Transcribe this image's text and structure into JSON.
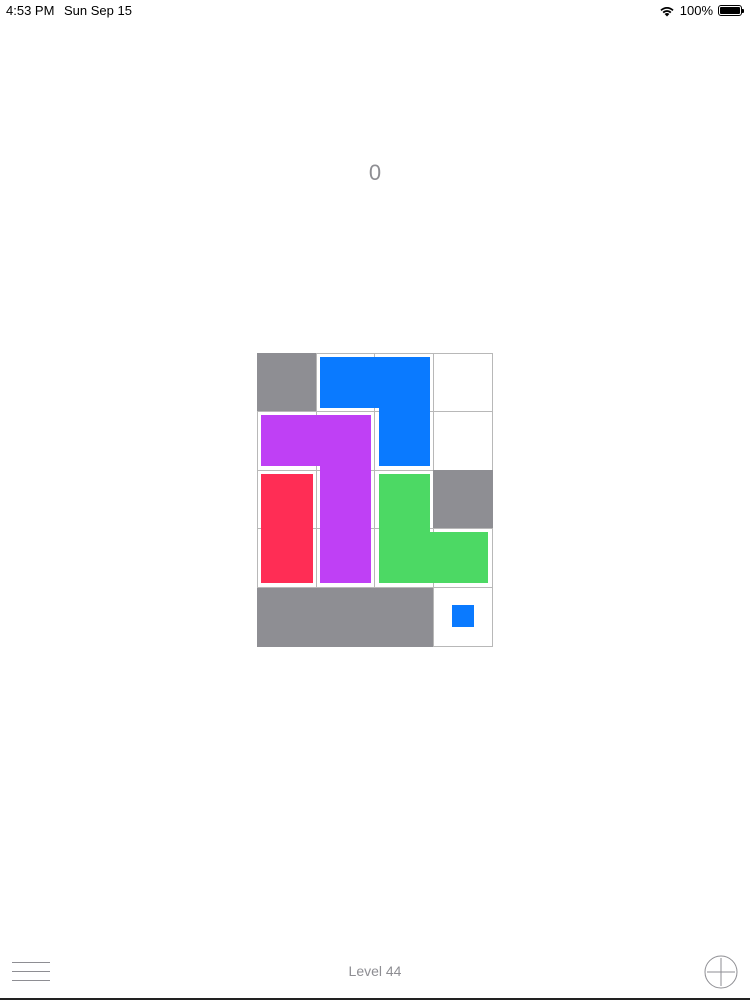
{
  "status_bar": {
    "time": "4:53 PM",
    "date": "Sun Sep 15",
    "battery": "100%"
  },
  "game": {
    "moves": "0",
    "colors": {
      "wall": "#8e8e93",
      "blue": "#0a7aff",
      "purple": "#bf40f5",
      "red": "#ff2d55",
      "green": "#4cd964"
    }
  },
  "footer": {
    "level_label": "Level 44"
  }
}
